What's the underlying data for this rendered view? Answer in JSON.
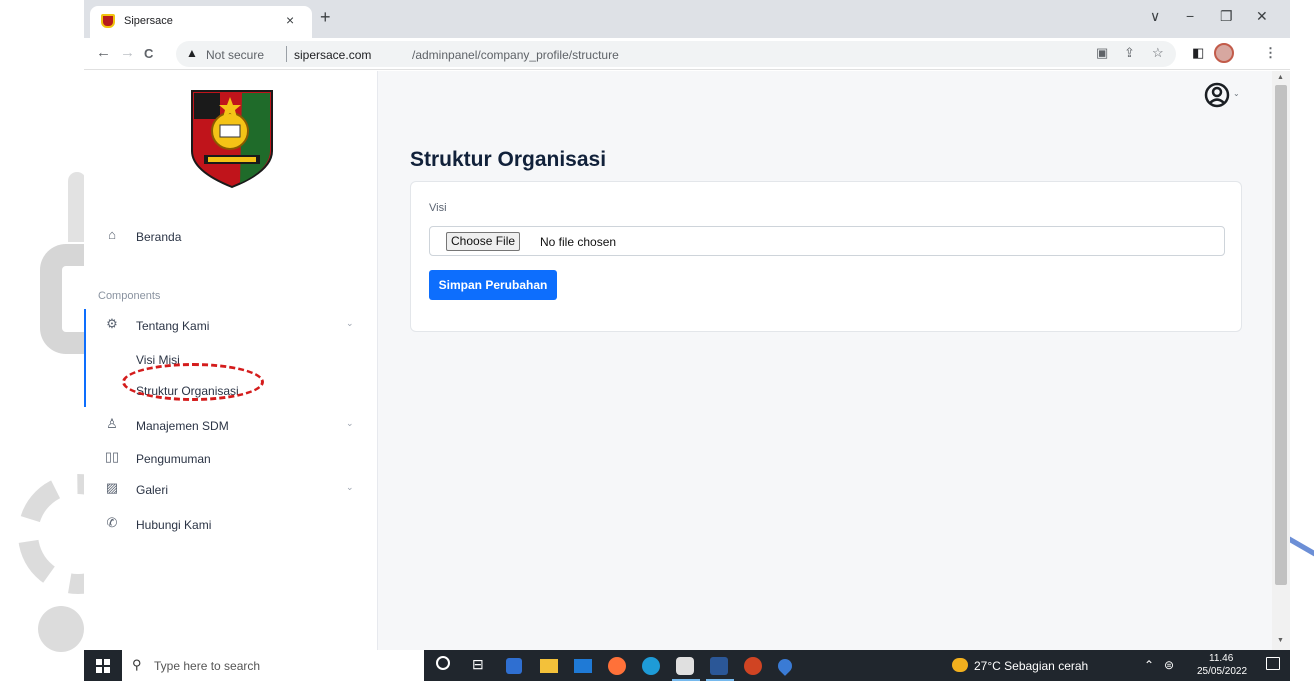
{
  "browser": {
    "tab_title": "Sipersace",
    "tab_close": "×",
    "new_tab": "+",
    "window_controls": {
      "dropdown": "∨",
      "minimize": "−",
      "restore": "❐",
      "close": "✕"
    },
    "nav": {
      "back": "←",
      "forward": "→",
      "reload": "C"
    },
    "address": {
      "security_icon": "▲",
      "security_label": "Not secure",
      "host": "sipersace.com",
      "path": "/adminpanel/company_profile/structure"
    },
    "toolbar_icons": [
      "translate-icon",
      "share-icon",
      "star-icon",
      "sidepanel-icon",
      "profile-icon",
      "menu-icon"
    ]
  },
  "sidebar": {
    "home_label": "Beranda",
    "section_label": "Components",
    "items": [
      {
        "label": "Tentang Kami",
        "icon": "gear-icon",
        "has_submenu": true
      },
      {
        "label": "Manajemen SDM",
        "icon": "person-icon",
        "has_submenu": true
      },
      {
        "label": "Pengumuman",
        "icon": "book-icon",
        "has_submenu": false
      },
      {
        "label": "Galeri",
        "icon": "image-icon",
        "has_submenu": true
      },
      {
        "label": "Hubungi Kami",
        "icon": "phone-icon",
        "has_submenu": false
      }
    ],
    "submenu": [
      "Visi Misi",
      "Struktur Organisasi"
    ],
    "chevron": "⌄"
  },
  "main": {
    "page_title": "Struktur Organisasi",
    "form": {
      "field_label": "Visi",
      "choose_file_label": "Choose File",
      "no_file_label": "No file chosen",
      "save_label": "Simpan Perubahan"
    }
  },
  "taskbar": {
    "search_placeholder": "Type here to search",
    "weather": "27°C  Sebagian cerah",
    "time": "11.46",
    "date": "25/05/2022"
  },
  "colors": {
    "primary": "#0d6efd",
    "annotation": "#d41c1c",
    "heading": "#11213a",
    "taskbar": "#20262d"
  }
}
